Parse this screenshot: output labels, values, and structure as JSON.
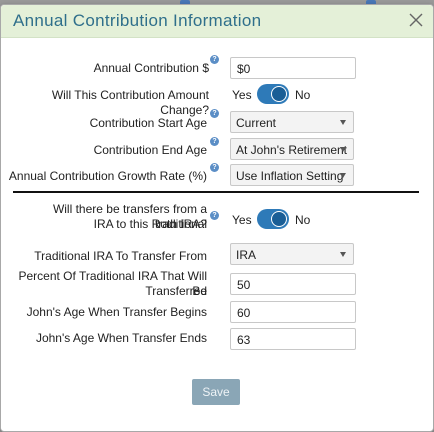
{
  "dialog": {
    "title": "Annual Contribution Information"
  },
  "fields": {
    "annual_contribution": {
      "label": "Annual Contribution $",
      "value": "$0"
    },
    "amount_change": {
      "label": "Will This Contribution Amount Change?",
      "yes": "Yes",
      "no": "No",
      "state": "on"
    },
    "start_age": {
      "label": "Contribution Start Age",
      "value": "Current"
    },
    "end_age": {
      "label": "Contribution End Age",
      "value": "At John's Retirement"
    },
    "growth_rate": {
      "label": "Annual Contribution Growth Rate (%)",
      "value": "Use Inflation Setting"
    },
    "transfers": {
      "label_line1": "Will there be transfers from a traditional",
      "label_line2": "IRA to this Roth IRA?",
      "yes": "Yes",
      "no": "No",
      "state": "on"
    },
    "traditional_ira": {
      "label": "Traditional IRA To Transfer From",
      "value": "IRA"
    },
    "percent_transferred": {
      "label_line1": "Percent Of Traditional IRA That Will Be",
      "label_line2": "Transferred",
      "value": "50"
    },
    "transfer_begins": {
      "label": "John's Age When Transfer Begins",
      "value": "60"
    },
    "transfer_ends": {
      "label": "John's Age When Transfer Ends",
      "value": "63"
    }
  },
  "buttons": {
    "save": "Save"
  },
  "colors": {
    "header_bg": "#e4f0d8",
    "title": "#2f6f8b",
    "toggle": "#2e7ab8",
    "save_bg": "#8aa6b6"
  },
  "icons": {
    "close": "close-icon",
    "help": "help-icon"
  }
}
